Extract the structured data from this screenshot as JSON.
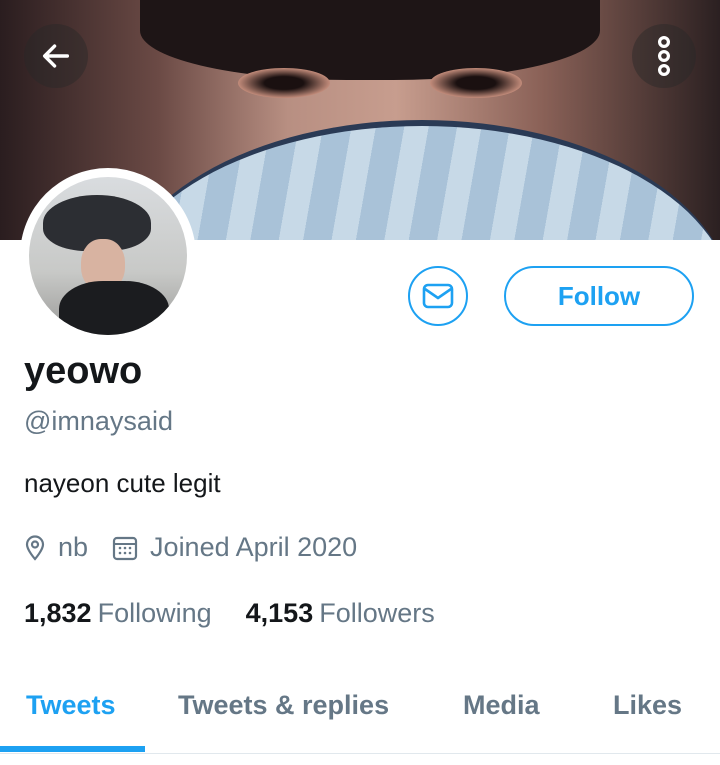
{
  "header": {
    "back_icon": "arrow-left-icon",
    "more_icon": "vertical-dots-icon"
  },
  "profile": {
    "name": "yeowo",
    "handle": "@imnaysaid",
    "bio": "nayeon cute legit",
    "location": "nb",
    "joined": "Joined April 2020",
    "following_count": "1,832",
    "following_label": "Following",
    "followers_count": "4,153",
    "followers_label": "Followers"
  },
  "actions": {
    "message_icon": "envelope-icon",
    "follow_label": "Follow"
  },
  "tabs": [
    {
      "label": "Tweets",
      "active": true
    },
    {
      "label": "Tweets & replies",
      "active": false
    },
    {
      "label": "Media",
      "active": false
    },
    {
      "label": "Likes",
      "active": false
    }
  ],
  "colors": {
    "accent": "#1da1f2",
    "secondary_text": "#657786",
    "primary_text": "#14171a"
  }
}
